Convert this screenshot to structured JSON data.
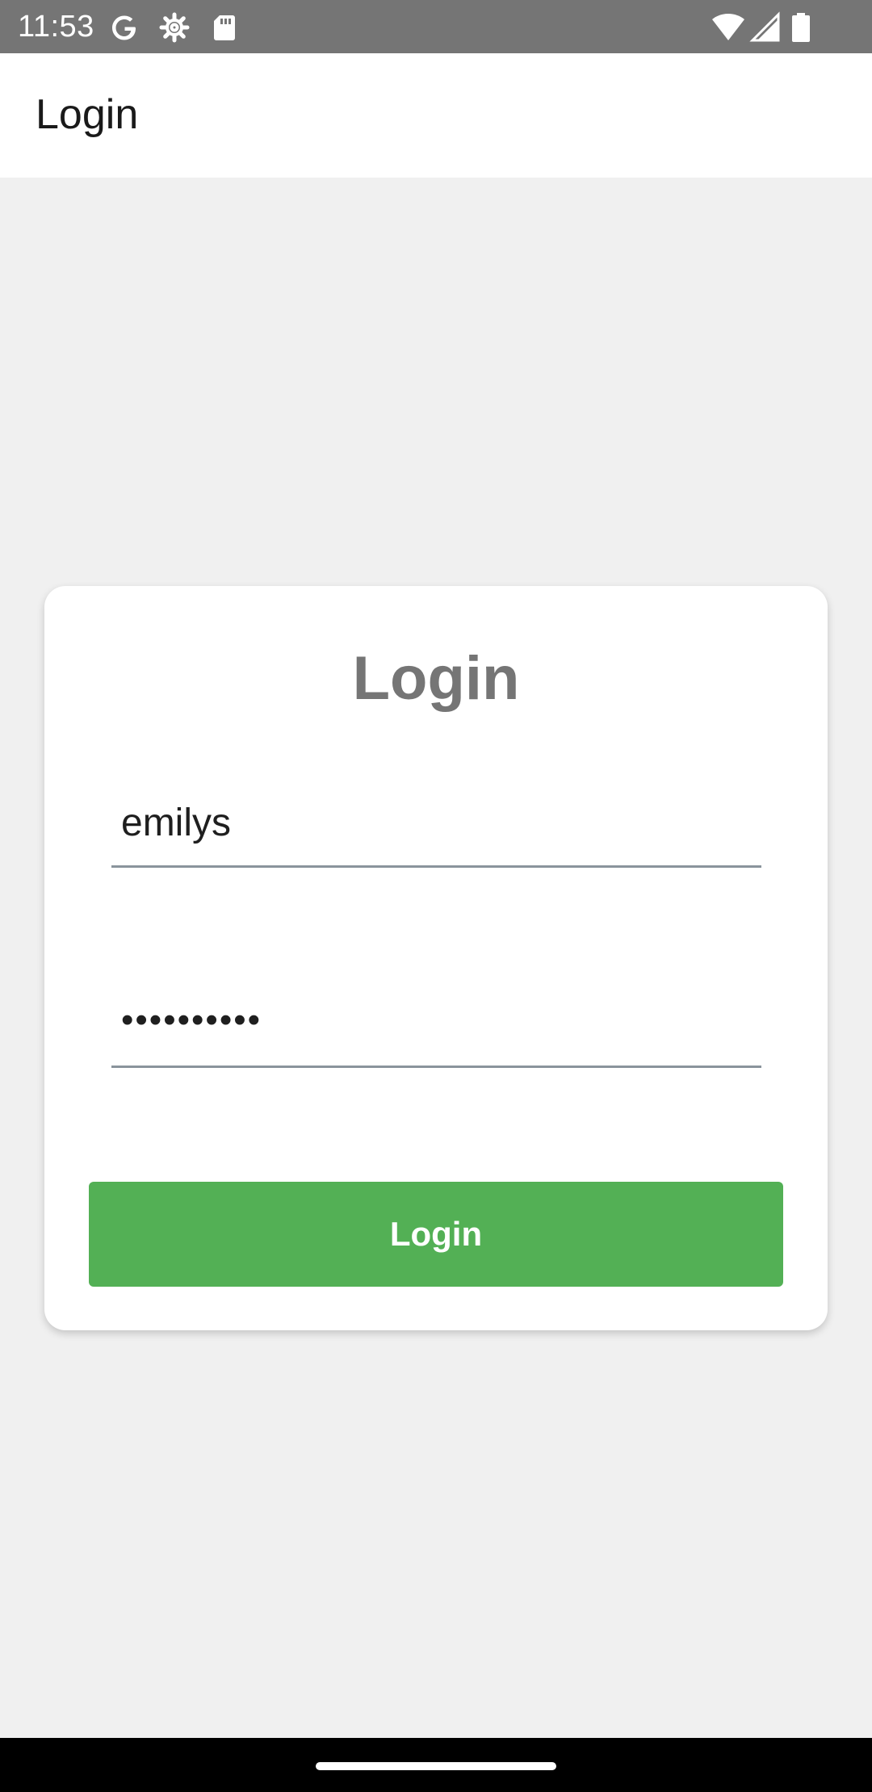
{
  "status_bar": {
    "time": "11:53",
    "left_icons": [
      "google-icon",
      "settings-gear-icon",
      "sd-card-icon"
    ],
    "right_icons": [
      "wifi-icon",
      "cellular-signal-icon",
      "battery-icon"
    ],
    "background": "#757575"
  },
  "app_bar": {
    "title": "Login"
  },
  "login_card": {
    "title": "Login",
    "username_value": "emilys",
    "password_value": "••••••••••",
    "button_label": "Login",
    "button_color": "#53b055"
  },
  "nav_bar": {
    "background": "#000000"
  }
}
